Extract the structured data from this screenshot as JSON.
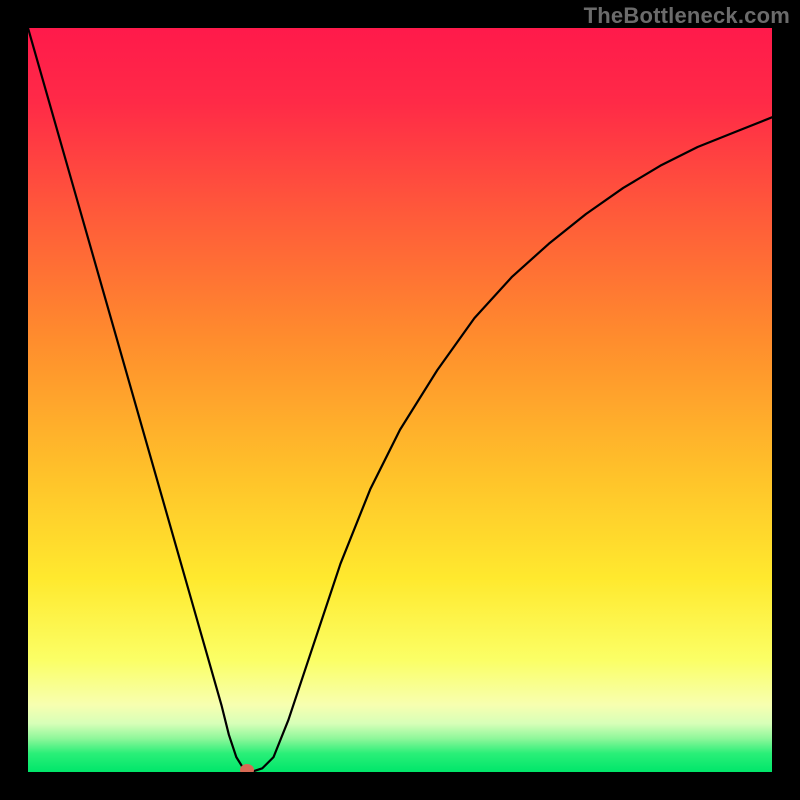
{
  "watermark": "TheBottleneck.com",
  "colors": {
    "band_red": "#ff1a4b",
    "band_orange": "#ff8a2a",
    "band_yellow": "#ffe92e",
    "band_liteyl": "#fdff8e",
    "band_green": "#00e66a",
    "curve": "#000000",
    "marker": "#d86a54"
  },
  "chart_data": {
    "type": "line",
    "title": "",
    "xlabel": "",
    "ylabel": "",
    "xlim": [
      0,
      100
    ],
    "ylim": [
      0,
      100
    ],
    "series": [
      {
        "name": "curve",
        "x": [
          0,
          2,
          4,
          6,
          8,
          10,
          12,
          14,
          16,
          18,
          20,
          22,
          24,
          26,
          27,
          28,
          29,
          30,
          31.5,
          33,
          35,
          38,
          42,
          46,
          50,
          55,
          60,
          65,
          70,
          75,
          80,
          85,
          90,
          95,
          100
        ],
        "y": [
          100,
          93,
          86,
          79,
          72,
          65,
          58,
          51,
          44,
          37,
          30,
          23,
          16,
          9,
          5,
          2,
          0.4,
          0,
          0.5,
          2,
          7,
          16,
          28,
          38,
          46,
          54,
          61,
          66.5,
          71,
          75,
          78.5,
          81.5,
          84,
          86,
          88
        ]
      }
    ],
    "marker": {
      "x": 29.5,
      "y": 0
    }
  }
}
